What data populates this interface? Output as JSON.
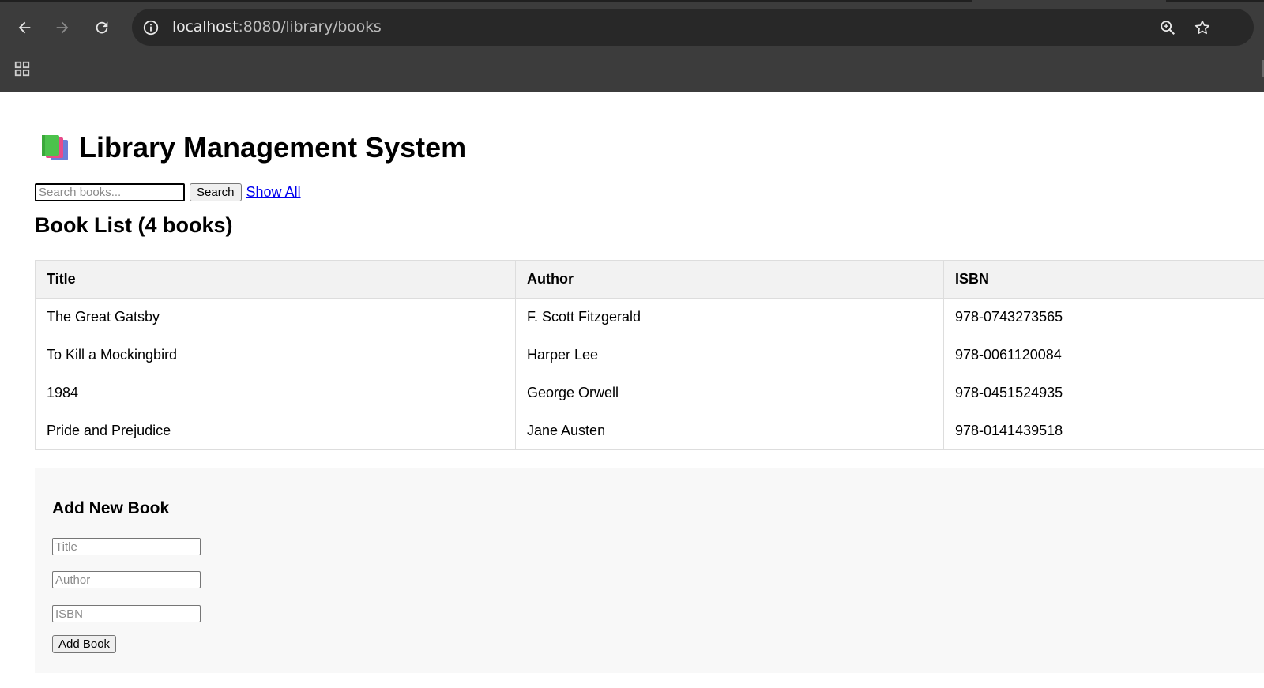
{
  "browser": {
    "url_host": "localhost",
    "url_rest": ":8080/library/books",
    "icons": [
      "back-icon",
      "forward-icon",
      "reload-icon",
      "site-info-icon",
      "zoom-icon",
      "bookmark-star-icon",
      "apps-grid-icon"
    ]
  },
  "page": {
    "title": "Library Management System",
    "title_icon": "books-icon",
    "search": {
      "placeholder": "Search books...",
      "value": "",
      "button_label": "Search",
      "show_all_label": "Show All"
    },
    "list_heading": "Book List (4 books)",
    "table": {
      "headers": [
        "Title",
        "Author",
        "ISBN"
      ],
      "rows": [
        [
          "The Great Gatsby",
          "F. Scott Fitzgerald",
          "978-0743273565"
        ],
        [
          "To Kill a Mockingbird",
          "Harper Lee",
          "978-0061120084"
        ],
        [
          "1984",
          "George Orwell",
          "978-0451524935"
        ],
        [
          "Pride and Prejudice",
          "Jane Austen",
          "978-0141439518"
        ]
      ]
    },
    "add_form": {
      "heading": "Add New Book",
      "title_placeholder": "Title",
      "author_placeholder": "Author",
      "isbn_placeholder": "ISBN",
      "button_label": "Add Book"
    }
  },
  "colors": {
    "chrome_bg": "#3c3c3c",
    "omnibox_bg": "#282828",
    "link": "#0000ee",
    "table_header_bg": "#f2f2f2",
    "form_bg": "#f8f8f8"
  }
}
